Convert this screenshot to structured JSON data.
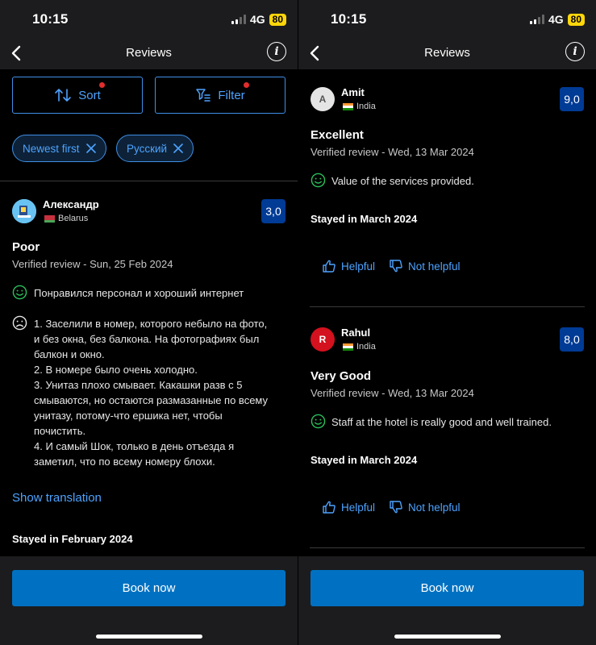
{
  "status": {
    "time": "10:15",
    "network": "4G",
    "battery": "80"
  },
  "nav": {
    "title": "Reviews"
  },
  "left": {
    "sort_label": "Sort",
    "filter_label": "Filter",
    "chips": [
      "Newest first",
      "Русский"
    ],
    "review": {
      "avatar_icon": "user-avatar-image",
      "name": "Александр",
      "country": "Belarus",
      "score": "3,0",
      "title": "Poor",
      "date": "Verified review - Sun, 25 Feb 2024",
      "positive": "Понравился персонал и хороший интернет",
      "negative": "1. Заселили в номер, которого небыло на фото,\nи без окна, без балкона. На фотографиях был\nбалкон и окно.\n2. В номере было очень холодно.\n3. Унитаз плохо смывает. Какашки разв с 5\nсмываются, но остаются размазанные по всему\nунитазу, потому-что ершика нет, чтобы\nпочистить.\n4. И самый Шок, только в день отъезда я\nзаметил, что по всему номеру блохи.",
      "show_translation": "Show translation",
      "stayed": "Stayed in February 2024"
    },
    "book_label": "Book now"
  },
  "right": {
    "reviews": [
      {
        "initial": "A",
        "name": "Amit",
        "country": "India",
        "score": "9,0",
        "title": "Excellent",
        "date": "Verified review - Wed, 13 Mar 2024",
        "positive": "Value of the services provided.",
        "stayed": "Stayed in March 2024",
        "helpful": "Helpful",
        "not_helpful": "Not helpful"
      },
      {
        "initial": "R",
        "name": "Rahul",
        "country": "India",
        "score": "8,0",
        "title": "Very Good",
        "date": "Verified review - Wed, 13 Mar 2024",
        "positive": "Staff at the hotel is really good and well trained.",
        "stayed": "Stayed in March 2024",
        "helpful": "Helpful",
        "not_helpful": "Not helpful"
      }
    ],
    "book_label": "Book now"
  },
  "colors": {
    "accent": "#4da3ff",
    "score_bg": "#003b95",
    "book_button": "#0071c2",
    "positive_icon": "#2bbf5c",
    "avatar_red": "#d4111e"
  }
}
